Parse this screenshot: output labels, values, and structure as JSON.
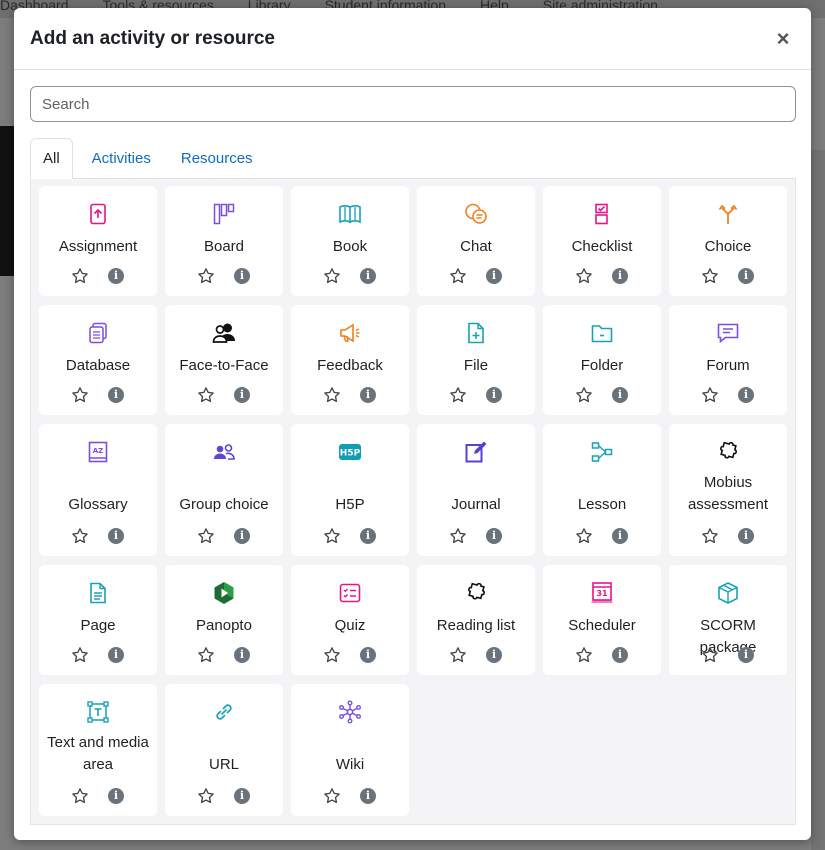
{
  "background": {
    "nav": [
      "Dashboard",
      "Tools & resources",
      "Library",
      "Student information",
      "Help",
      "Site administration"
    ]
  },
  "modal": {
    "title": "Add an activity or resource",
    "close_label": "×"
  },
  "search": {
    "placeholder": "Search"
  },
  "tabs": [
    {
      "label": "All",
      "active": true
    },
    {
      "label": "Activities",
      "active": false
    },
    {
      "label": "Resources",
      "active": false
    }
  ],
  "items": [
    {
      "label": "Assignment",
      "icon": "assignment-icon",
      "color": "#e7148a"
    },
    {
      "label": "Board",
      "icon": "board-icon",
      "color": "#7b4ee0"
    },
    {
      "label": "Book",
      "icon": "book-icon",
      "color": "#17a2b8"
    },
    {
      "label": "Chat",
      "icon": "chat-icon",
      "color": "#f17f1a"
    },
    {
      "label": "Checklist",
      "icon": "checklist-icon",
      "color": "#e7148a"
    },
    {
      "label": "Choice",
      "icon": "choice-icon",
      "color": "#f17f1a"
    },
    {
      "label": "Database",
      "icon": "database-icon",
      "color": "#7b4ee0"
    },
    {
      "label": "Face-to-Face",
      "icon": "face-to-face-icon",
      "color": "#111111"
    },
    {
      "label": "Feedback",
      "icon": "feedback-icon",
      "color": "#f17f1a"
    },
    {
      "label": "File",
      "icon": "file-icon",
      "color": "#17a2b8"
    },
    {
      "label": "Folder",
      "icon": "folder-icon",
      "color": "#17a2b8"
    },
    {
      "label": "Forum",
      "icon": "forum-icon",
      "color": "#7b4ee0"
    },
    {
      "label": "Glossary",
      "icon": "glossary-icon",
      "color": "#7b4ee0"
    },
    {
      "label": "Group choice",
      "icon": "group-choice-icon",
      "color": "#5b46d6"
    },
    {
      "label": "H5P",
      "icon": "h5p-icon",
      "color": "#0e9fb0"
    },
    {
      "label": "Journal",
      "icon": "journal-icon",
      "color": "#5b3fd3"
    },
    {
      "label": "Lesson",
      "icon": "lesson-icon",
      "color": "#17a2b8"
    },
    {
      "label": "Mobius assessment",
      "icon": "puzzle-icon",
      "color": "#111111"
    },
    {
      "label": "Page",
      "icon": "page-icon",
      "color": "#17a2b8"
    },
    {
      "label": "Panopto",
      "icon": "panopto-icon",
      "color": "#2e9e46"
    },
    {
      "label": "Quiz",
      "icon": "quiz-icon",
      "color": "#e7148a"
    },
    {
      "label": "Reading list",
      "icon": "puzzle-icon",
      "color": "#111111"
    },
    {
      "label": "Scheduler",
      "icon": "scheduler-icon",
      "color": "#e7148a"
    },
    {
      "label": "SCORM package",
      "icon": "scorm-icon",
      "color": "#17a2b8"
    },
    {
      "label": "Text and media area",
      "icon": "text-media-icon",
      "color": "#17a2b8"
    },
    {
      "label": "URL",
      "icon": "url-icon",
      "color": "#17a2b8"
    },
    {
      "label": "Wiki",
      "icon": "wiki-icon",
      "color": "#7b4ee0"
    }
  ],
  "info_glyph": "i"
}
